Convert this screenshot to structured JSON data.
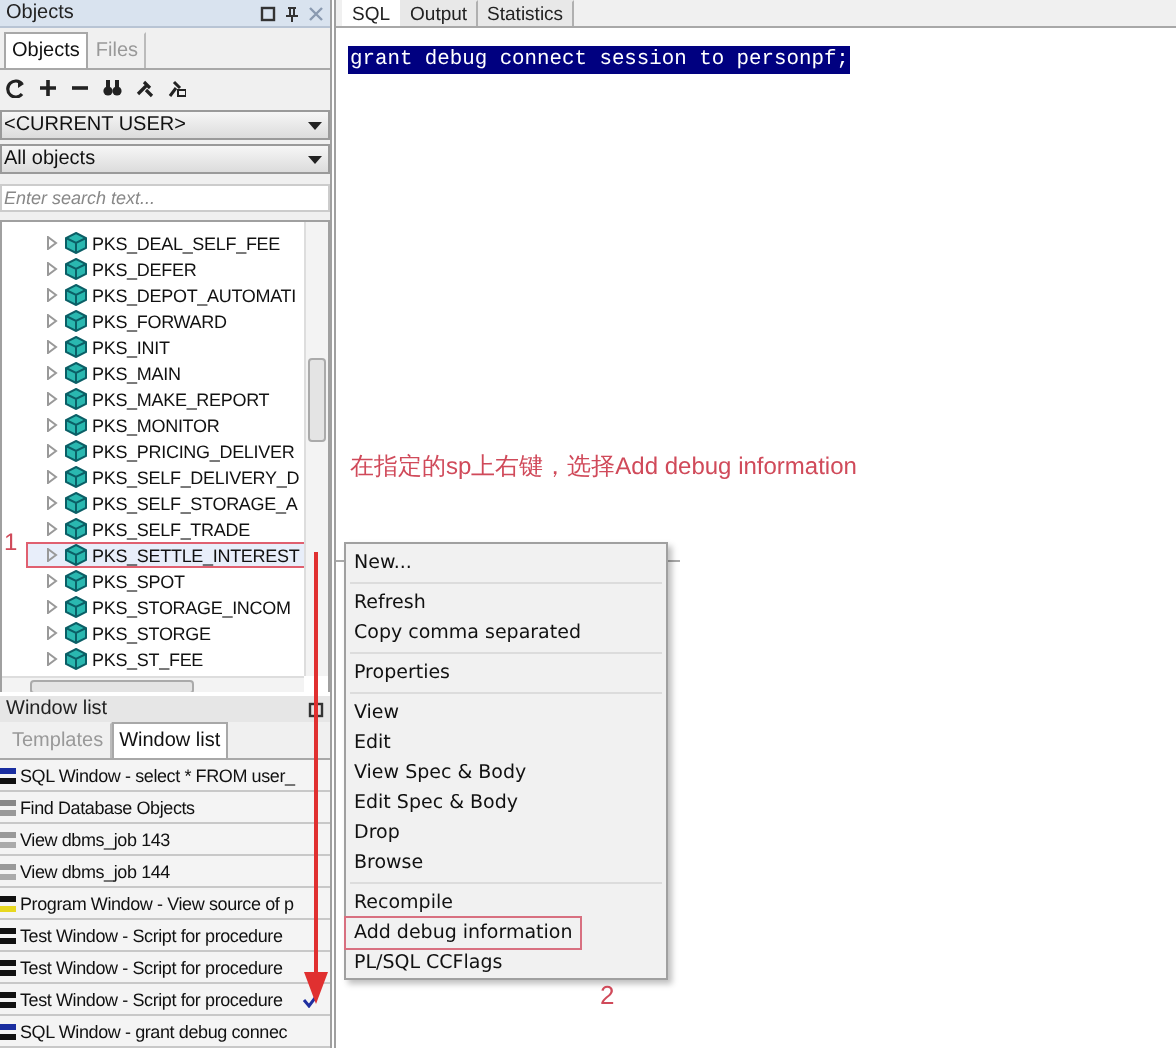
{
  "objects_panel": {
    "title": "Objects",
    "tabs": [
      {
        "label": "Objects",
        "selected": true
      },
      {
        "label": "Files",
        "selected": false
      }
    ],
    "owner_dropdown": "<CURRENT USER>",
    "filter_dropdown": "All objects",
    "search": {
      "placeholder": "Enter search text..."
    },
    "tree": [
      {
        "label": "PKS_DEAL_SELF_FEE",
        "selected": false
      },
      {
        "label": "PKS_DEFER",
        "selected": false
      },
      {
        "label": "PKS_DEPOT_AUTOMATI",
        "selected": false
      },
      {
        "label": "PKS_FORWARD",
        "selected": false
      },
      {
        "label": "PKS_INIT",
        "selected": false
      },
      {
        "label": "PKS_MAIN",
        "selected": false
      },
      {
        "label": "PKS_MAKE_REPORT",
        "selected": false
      },
      {
        "label": "PKS_MONITOR",
        "selected": false
      },
      {
        "label": "PKS_PRICING_DELIVER",
        "selected": false
      },
      {
        "label": "PKS_SELF_DELIVERY_D",
        "selected": false
      },
      {
        "label": "PKS_SELF_STORAGE_A",
        "selected": false
      },
      {
        "label": "PKS_SELF_TRADE",
        "selected": false
      },
      {
        "label": "PKS_SETTLE_INTEREST",
        "selected": true
      },
      {
        "label": "PKS_SPOT",
        "selected": false
      },
      {
        "label": "PKS_STORAGE_INCOM",
        "selected": false
      },
      {
        "label": "PKS_STORGE",
        "selected": false
      },
      {
        "label": "PKS_ST_FEE",
        "selected": false
      }
    ]
  },
  "window_list_panel": {
    "title": "Window list",
    "tabs": [
      {
        "label": "Templates",
        "selected": false
      },
      {
        "label": "Window list",
        "selected": true
      }
    ],
    "windows": [
      {
        "kind": "sql",
        "label": "SQL Window - select * FROM user_",
        "checked": false
      },
      {
        "kind": "find",
        "label": "Find Database Objects",
        "checked": false
      },
      {
        "kind": "view",
        "label": "View dbms_job 143",
        "checked": false
      },
      {
        "kind": "view",
        "label": "View dbms_job 144",
        "checked": false
      },
      {
        "kind": "program",
        "label": "Program Window - View source of p",
        "checked": false
      },
      {
        "kind": "test",
        "label": "Test Window - Script for procedure",
        "checked": false
      },
      {
        "kind": "test",
        "label": "Test Window - Script for procedure",
        "checked": false
      },
      {
        "kind": "test",
        "label": "Test Window - Script for procedure",
        "checked": true
      },
      {
        "kind": "sql",
        "label": "SQL Window - grant debug connec",
        "checked": false
      }
    ]
  },
  "editor": {
    "tabs": [
      {
        "label": "SQL",
        "selected": true
      },
      {
        "label": "Output",
        "selected": false
      },
      {
        "label": "Statistics",
        "selected": false
      }
    ],
    "sql_text": "grant debug connect session to personpf;",
    "text_selected": true
  },
  "context_menu": {
    "groups": [
      [
        {
          "label": "New...",
          "annotated": false
        }
      ],
      [
        {
          "label": "Refresh",
          "annotated": false
        },
        {
          "label": "Copy comma separated",
          "annotated": false
        }
      ],
      [
        {
          "label": "Properties",
          "annotated": false
        }
      ],
      [
        {
          "label": "View",
          "annotated": false
        },
        {
          "label": "Edit",
          "annotated": false
        },
        {
          "label": "View Spec & Body",
          "annotated": false
        },
        {
          "label": "Edit Spec & Body",
          "annotated": false
        },
        {
          "label": "Drop",
          "annotated": false
        },
        {
          "label": "Browse",
          "annotated": false
        }
      ],
      [
        {
          "label": "Recompile",
          "annotated": false
        },
        {
          "label": "Add debug information",
          "annotated": true
        },
        {
          "label": "PL/SQL CCFlags",
          "annotated": false
        }
      ]
    ]
  },
  "annotations": {
    "instruction": "在指定的sp上右键，选择Add debug information",
    "step_1": "1",
    "step_2": "2"
  }
}
